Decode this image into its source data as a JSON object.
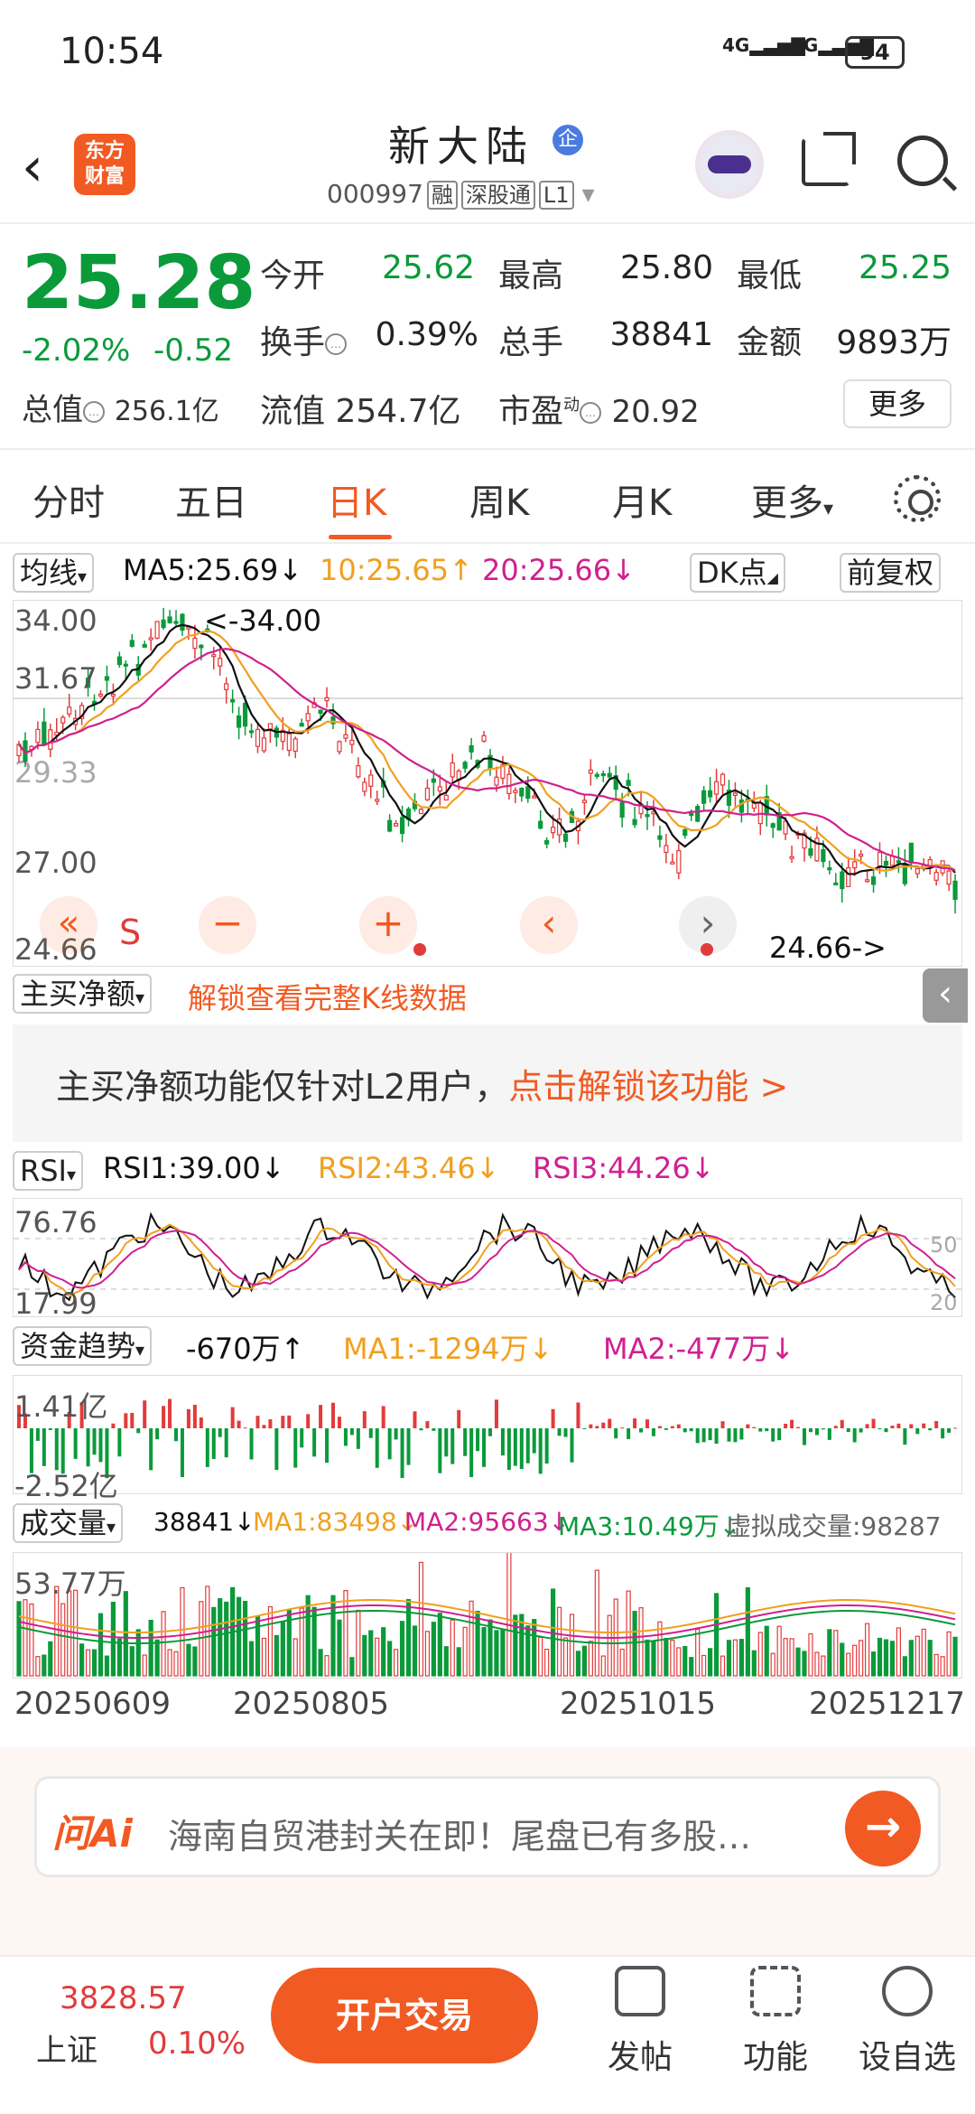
{
  "status_bar": {
    "time": "10:54",
    "signal1": "4G",
    "signal2": "4G",
    "battery": "94"
  },
  "header": {
    "title": "新大陆",
    "badge": "企",
    "code": "000997",
    "tags": [
      "融",
      "深股通",
      "L1"
    ],
    "logo_line1": "东方",
    "logo_line2": "财富"
  },
  "quote": {
    "price": "25.28",
    "change_pct": "-2.02%",
    "change": "-0.52",
    "open_label": "今开",
    "open": "25.62",
    "high_label": "最高",
    "high": "25.80",
    "low_label": "最低",
    "low": "25.25",
    "turnover_label": "换手",
    "turnover": "0.39%",
    "volume_label": "总手",
    "volume": "38841",
    "amount_label": "金额",
    "amount": "9893万",
    "mktcap_label": "总值",
    "mktcap": "256.1亿",
    "float_label": "流值",
    "float": "254.7亿",
    "pe_label": "市盈",
    "pe_sup": "动",
    "pe": "20.92",
    "more": "更多"
  },
  "tabs": [
    "分时",
    "五日",
    "日K",
    "周K",
    "月K",
    "更多"
  ],
  "active_tab": "日K",
  "kline": {
    "ma_selector": "均线",
    "ma5": "MA5:25.69↓",
    "ma10": "10:25.65↑",
    "ma20": "20:25.66↓",
    "dk": "DK点",
    "adjust": "前复权",
    "y_ticks": [
      "34.00",
      "31.67",
      "29.33",
      "27.00",
      "24.66"
    ],
    "max_label": "<-34.00",
    "min_label": "24.66->",
    "s_mark": "S",
    "colors": {
      "ma5": "#111111",
      "ma10": "#f0a020",
      "ma20": "#d0208f",
      "up": "#e23b3b",
      "down": "#0a9a3a"
    }
  },
  "net_buy": {
    "selector": "主买净额",
    "unlock": "解锁查看完整K线数据",
    "message": "主买净额功能仅针对L2用户，",
    "message_link": "点击解锁该功能 >"
  },
  "rsi": {
    "selector": "RSI",
    "rsi1": "RSI1:39.00↓",
    "rsi2": "RSI2:43.46↓",
    "rsi3": "RSI3:44.26↓",
    "y_top": "76.76",
    "y_bottom": "17.99",
    "r50": "50",
    "r20": "20"
  },
  "capital": {
    "selector": "资金趋势",
    "value": "-670万↑",
    "ma1": "MA1:-1294万↓",
    "ma2": "MA2:-477万↓",
    "y_top": "1.41亿",
    "y_bottom": "-2.52亿"
  },
  "volume": {
    "selector": "成交量",
    "value": "38841↓",
    "ma1": "MA1:83498↓",
    "ma2": "MA2:95663↓",
    "ma3": "MA3:10.49万↓",
    "virtual": "虚拟成交量:98287",
    "y_top": "53.77万"
  },
  "dates": [
    "20250609",
    "20250805",
    "20251015",
    "20251217"
  ],
  "ai": {
    "logo": "问Ai",
    "text": "海南自贸港封关在即！尾盘已有多股…"
  },
  "bottom": {
    "index_value": "3828.57",
    "index_name": "上证",
    "index_pct": "0.10%",
    "open_button": "开户交易",
    "nav": [
      "发帖",
      "功能",
      "设自选"
    ]
  }
}
